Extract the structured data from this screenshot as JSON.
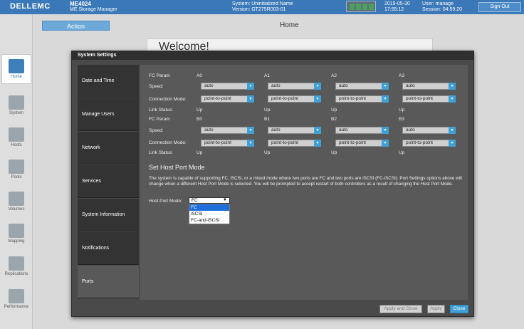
{
  "header": {
    "brand": "DELLEMC",
    "product": "ME4024",
    "product_sub": "ME Storage Manager",
    "system_line": "System: Uninitialized Name",
    "version_line": "Version: GT275R003-01",
    "date": "2019-05-30",
    "time": "17:55:12",
    "user_line": "User: manage",
    "session_line": "Session: 04:59:20",
    "sign_out": "Sign Out"
  },
  "rail": {
    "items": [
      {
        "label": "Home",
        "icon": "home-icon"
      },
      {
        "label": "System",
        "icon": "system-icon"
      },
      {
        "label": "Hosts",
        "icon": "hosts-icon"
      },
      {
        "label": "Pools",
        "icon": "pools-icon"
      },
      {
        "label": "Volumes",
        "icon": "volumes-icon"
      },
      {
        "label": "Mapping",
        "icon": "mapping-icon"
      },
      {
        "label": "Replications",
        "icon": "replications-icon"
      },
      {
        "label": "Performance",
        "icon": "performance-icon"
      }
    ]
  },
  "page": {
    "action": "Action",
    "title": "Home",
    "welcome": "Welcome!"
  },
  "modal": {
    "title": "System Settings",
    "tabs": [
      "Date and Time",
      "Manage Users",
      "Network",
      "Services",
      "System Information",
      "Notifications",
      "Ports"
    ],
    "active_tab": "Ports",
    "ports": {
      "fc_param_label": "FC Param",
      "speed_label": "Speed:",
      "conn_label": "Connection Mode:",
      "link_label": "Link Status:",
      "groupA": {
        "names": [
          "A0",
          "A1",
          "A2",
          "A3"
        ],
        "speed": [
          "auto",
          "auto",
          "auto",
          "auto"
        ],
        "conn": [
          "point-to-point",
          "point-to-point",
          "point-to-point",
          "point-to-point"
        ],
        "link": [
          "Up",
          "Up",
          "Up",
          "Up"
        ]
      },
      "groupB": {
        "names": [
          "B0",
          "B1",
          "B2",
          "B3"
        ],
        "speed": [
          "auto",
          "auto",
          "auto",
          "auto"
        ],
        "conn": [
          "point-to-point",
          "point-to-point",
          "point-to-point",
          "point-to-point"
        ],
        "link": [
          "Up",
          "Up",
          "Up",
          "Up"
        ]
      }
    },
    "host_port": {
      "title": "Set Host Port Mode",
      "description": "The system is capable of supporting FC, iSCSI, or a mixed mode where two ports are FC and two ports are iSCSI (FC-iSCSI). Port Settings options above will change when a different Host Port Mode is selected. You will be prompted to accept restart of both controllers as a result of changing the Host Port Mode.",
      "label": "Host Port Mode:",
      "selected": "FC",
      "options": [
        "FC",
        "iSCSI",
        "FC-and-iSCSI"
      ]
    },
    "buttons": {
      "apply_close": "Apply and Close",
      "apply": "Apply",
      "close": "Close"
    }
  },
  "colors": {
    "topbar": "#3a78b8",
    "accent": "#3fa1d6",
    "modal_bg": "#4a4a4a"
  }
}
